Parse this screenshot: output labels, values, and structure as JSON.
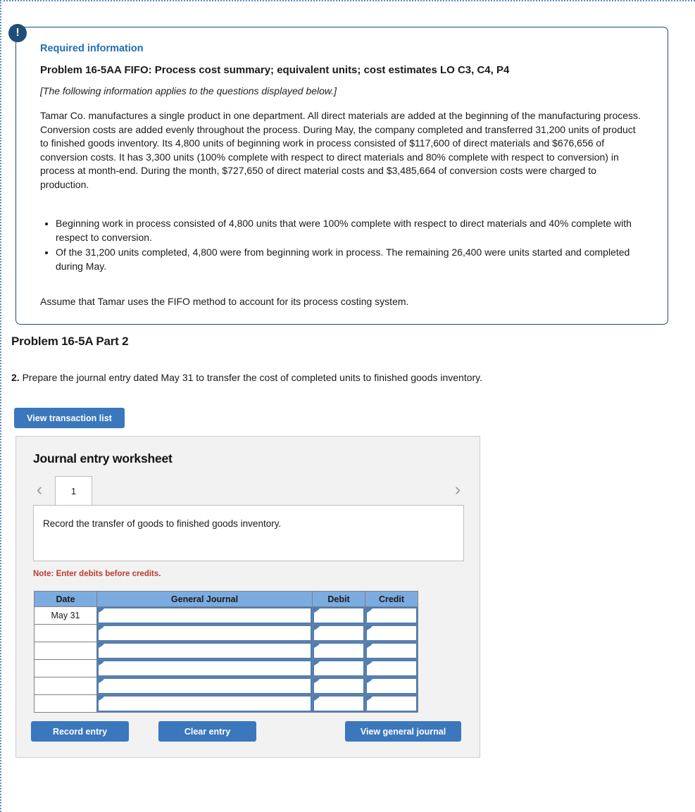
{
  "required_info": {
    "badge_icon": "exclamation-icon",
    "badge_glyph": "!",
    "label": "Required information",
    "title": "Problem 16-5AA FIFO: Process cost summary; equivalent units; cost estimates LO C3, C4, P4",
    "applies_note": "[The following information applies to the questions displayed below.]",
    "paragraph": "Tamar Co. manufactures a single product in one department. All direct materials are added at the beginning of the manufacturing process. Conversion costs are added evenly throughout the process. During May, the company completed and transferred 31,200 units of product to finished goods inventory. Its 4,800 units of beginning work in process consisted of $117,600 of direct materials and $676,656 of conversion costs. It has 3,300 units (100% complete with respect to direct materials and 80% complete with respect to conversion) in process at month-end. During the month, $727,650 of direct material costs and $3,485,664 of conversion costs were charged to production.",
    "bullets": [
      "Beginning work in process consisted of 4,800 units that were 100% complete with respect to direct materials and 40% complete with respect to conversion.",
      "Of the 31,200 units completed, 4,800 were from beginning work in process. The remaining 26,400 were units started and completed during May."
    ],
    "assumption": "Assume that Tamar uses the FIFO method to account for its process costing system."
  },
  "part": {
    "heading": "Problem 16-5A Part 2",
    "question_number": "2.",
    "question_text": " Prepare the journal entry dated May 31 to transfer the cost of completed units to finished goods inventory.",
    "view_transaction_list_label": "View transaction list"
  },
  "worksheet": {
    "title": "Journal entry worksheet",
    "prev_icon": "chevron-left-icon",
    "prev_glyph": "‹",
    "next_icon": "chevron-right-icon",
    "next_glyph": "›",
    "tabs": [
      {
        "label": "1",
        "active": true
      }
    ],
    "description": "Record the transfer of goods to finished goods inventory.",
    "note": "Note: Enter debits before credits.",
    "table": {
      "columns": [
        "Date",
        "General Journal",
        "Debit",
        "Credit"
      ],
      "rows": [
        {
          "date": "May 31",
          "general_journal": "",
          "debit": "",
          "credit": ""
        },
        {
          "date": "",
          "general_journal": "",
          "debit": "",
          "credit": ""
        },
        {
          "date": "",
          "general_journal": "",
          "debit": "",
          "credit": ""
        },
        {
          "date": "",
          "general_journal": "",
          "debit": "",
          "credit": ""
        },
        {
          "date": "",
          "general_journal": "",
          "debit": "",
          "credit": ""
        },
        {
          "date": "",
          "general_journal": "",
          "debit": "",
          "credit": ""
        }
      ]
    },
    "buttons": {
      "record_entry": "Record entry",
      "clear_entry": "Clear entry",
      "view_general_journal": "View general journal"
    }
  },
  "colors": {
    "accent_blue": "#3b77bc",
    "card_border": "#1f4e79",
    "badge_bg": "#1f4e79",
    "label_blue": "#1f6fb5",
    "table_header_blue": "#7cabdf",
    "cell_border_blue": "#4a7ebb",
    "note_red": "#c0392b",
    "panel_bg": "#f2f2f2",
    "selection_dotted": "#5b8fc9"
  }
}
